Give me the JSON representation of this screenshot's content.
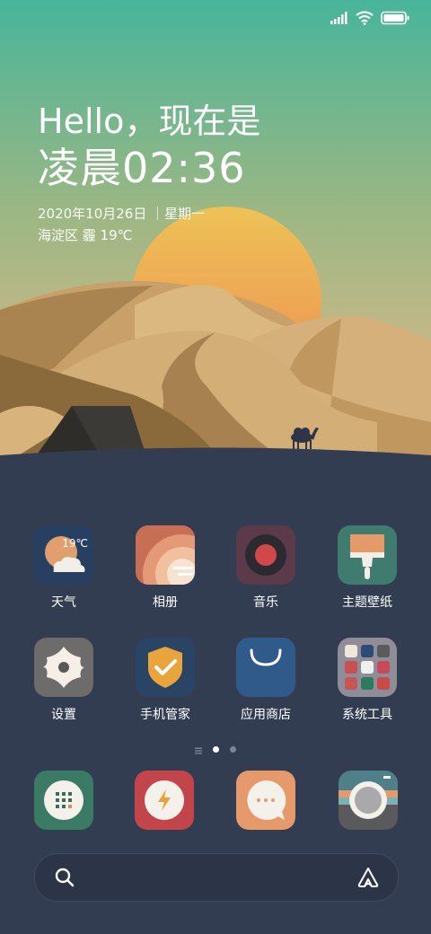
{
  "status_bar": {
    "icons": [
      "signal-icon",
      "wifi-icon",
      "battery-icon"
    ]
  },
  "clock": {
    "greeting": "Hello，现在是",
    "time": "凌晨02:36",
    "date": "2020年10月26日 ｜星期一",
    "location_weather": "海淀区  霾  19℃"
  },
  "apps": [
    {
      "label": "天气",
      "icon": "weather-icon",
      "badge": "19℃"
    },
    {
      "label": "相册",
      "icon": "gallery-icon"
    },
    {
      "label": "音乐",
      "icon": "music-icon"
    },
    {
      "label": "主题壁纸",
      "icon": "themes-icon"
    },
    {
      "label": "设置",
      "icon": "settings-icon"
    },
    {
      "label": "手机管家",
      "icon": "security-icon"
    },
    {
      "label": "应用商店",
      "icon": "app-store-icon"
    },
    {
      "label": "系统工具",
      "icon": "tools-folder-icon"
    }
  ],
  "page_indicator": {
    "pages": 2,
    "current": 1
  },
  "dock": [
    {
      "icon": "phone-icon"
    },
    {
      "icon": "browser-icon"
    },
    {
      "icon": "messages-icon"
    },
    {
      "icon": "camera-icon"
    }
  ],
  "search_bar": {
    "left_icon": "search-icon",
    "right_icon": "assistant-icon"
  },
  "colors": {
    "sky_top": "#48b59a",
    "sky_bottom": "#e8b98a",
    "sun": "#e8a24a",
    "dune_dark": "#8c6c3c",
    "dune_light": "#d9b47c",
    "ground": "#333d52"
  }
}
